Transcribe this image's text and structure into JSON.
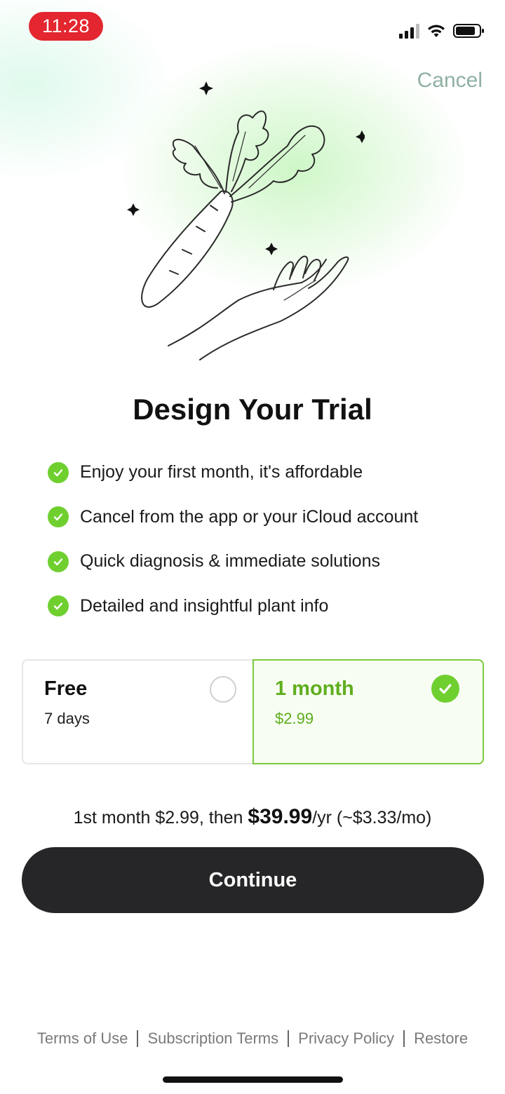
{
  "status_bar": {
    "time": "11:28",
    "signal_icon": "cellular-signal-icon",
    "wifi_icon": "wifi-icon",
    "battery_icon": "battery-icon"
  },
  "header": {
    "cancel_label": "Cancel"
  },
  "hero": {
    "illustration": "carrot-in-hand-illustration"
  },
  "title": "Design Your Trial",
  "features": [
    "Enjoy your first month, it's affordable",
    "Cancel from the app or your iCloud account",
    "Quick diagnosis & immediate solutions",
    "Detailed and insightful plant info"
  ],
  "plans": {
    "free": {
      "name": "Free",
      "subtitle": "7 days",
      "selected": false
    },
    "month": {
      "name": "1 month",
      "subtitle": "$2.99",
      "selected": true
    }
  },
  "pricing": {
    "prefix": "1st month $2.99, then ",
    "price": "$39.99",
    "suffix": "/yr (~$3.33/mo)"
  },
  "continue_label": "Continue",
  "footer": {
    "terms_of_use": "Terms of Use",
    "subscription_terms": "Subscription Terms",
    "privacy_policy": "Privacy Policy",
    "restore": "Restore"
  },
  "colors": {
    "accent_green": "#6fcf2f",
    "plan_green_text": "#5fae1e",
    "button_dark": "#262628",
    "time_pill_red": "#e3262f",
    "cancel_text": "#8fb0a2"
  }
}
